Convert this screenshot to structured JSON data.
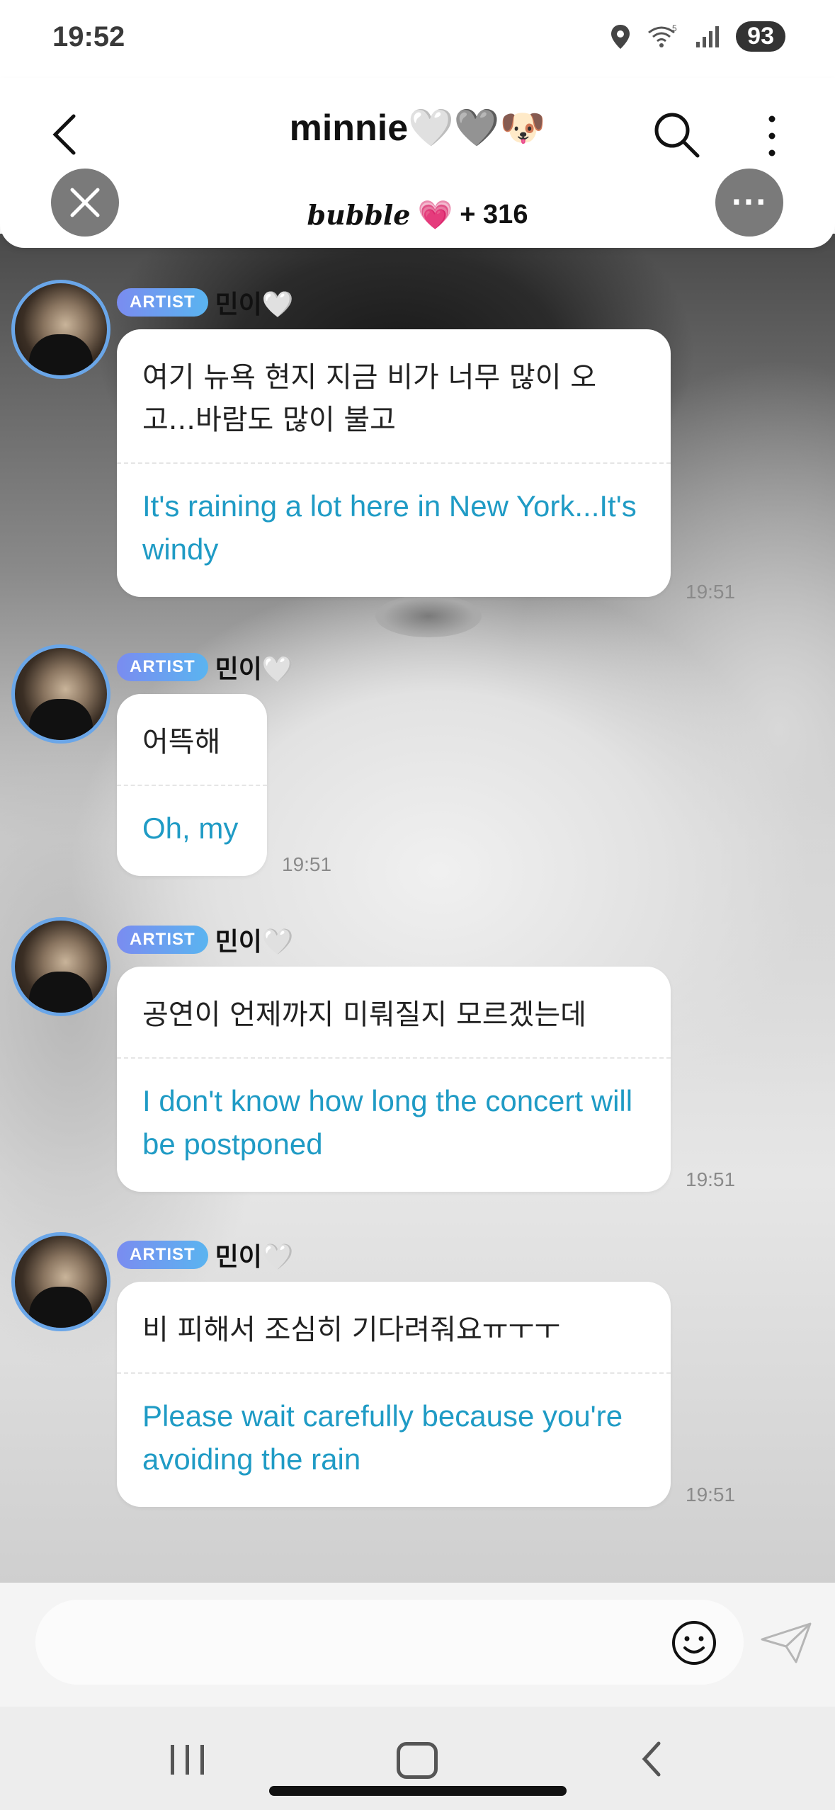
{
  "status_bar": {
    "time": "19:52",
    "battery": "93",
    "wifi_label": "5"
  },
  "header": {
    "title": "minnie🤍🩶🐶",
    "bubble_logo": "bubble",
    "bubble_heart": "💗",
    "bubble_count": "+ 316",
    "opts_label": "···"
  },
  "messages": [
    {
      "badge": "ARTIST",
      "name": "민이🤍",
      "ko": "여기 뉴욕 현지 지금 비가 너무 많이 오고...바람도 많이 불고",
      "en": "It's raining a lot here in New York...It's windy",
      "time": "19:51"
    },
    {
      "badge": "ARTIST",
      "name": "민이🤍",
      "ko": "어뜩해",
      "en": "Oh, my",
      "time": "19:51"
    },
    {
      "badge": "ARTIST",
      "name": "민이🤍",
      "ko": "공연이 언제까지 미뤄질지 모르겠는데",
      "en": "I don't know how long the concert will be postponed",
      "time": "19:51"
    },
    {
      "badge": "ARTIST",
      "name": "민이🤍",
      "ko": "비 피해서 조심히 기다려줘요ㅠㅜㅜ",
      "en": "Please wait carefully because you're avoiding the rain",
      "time": "19:51"
    }
  ],
  "icons": {
    "back": "chevron-left-icon",
    "search": "search-icon",
    "more": "more-vertical-icon",
    "close": "close-icon",
    "emoji": "smile-icon",
    "send": "send-icon"
  }
}
